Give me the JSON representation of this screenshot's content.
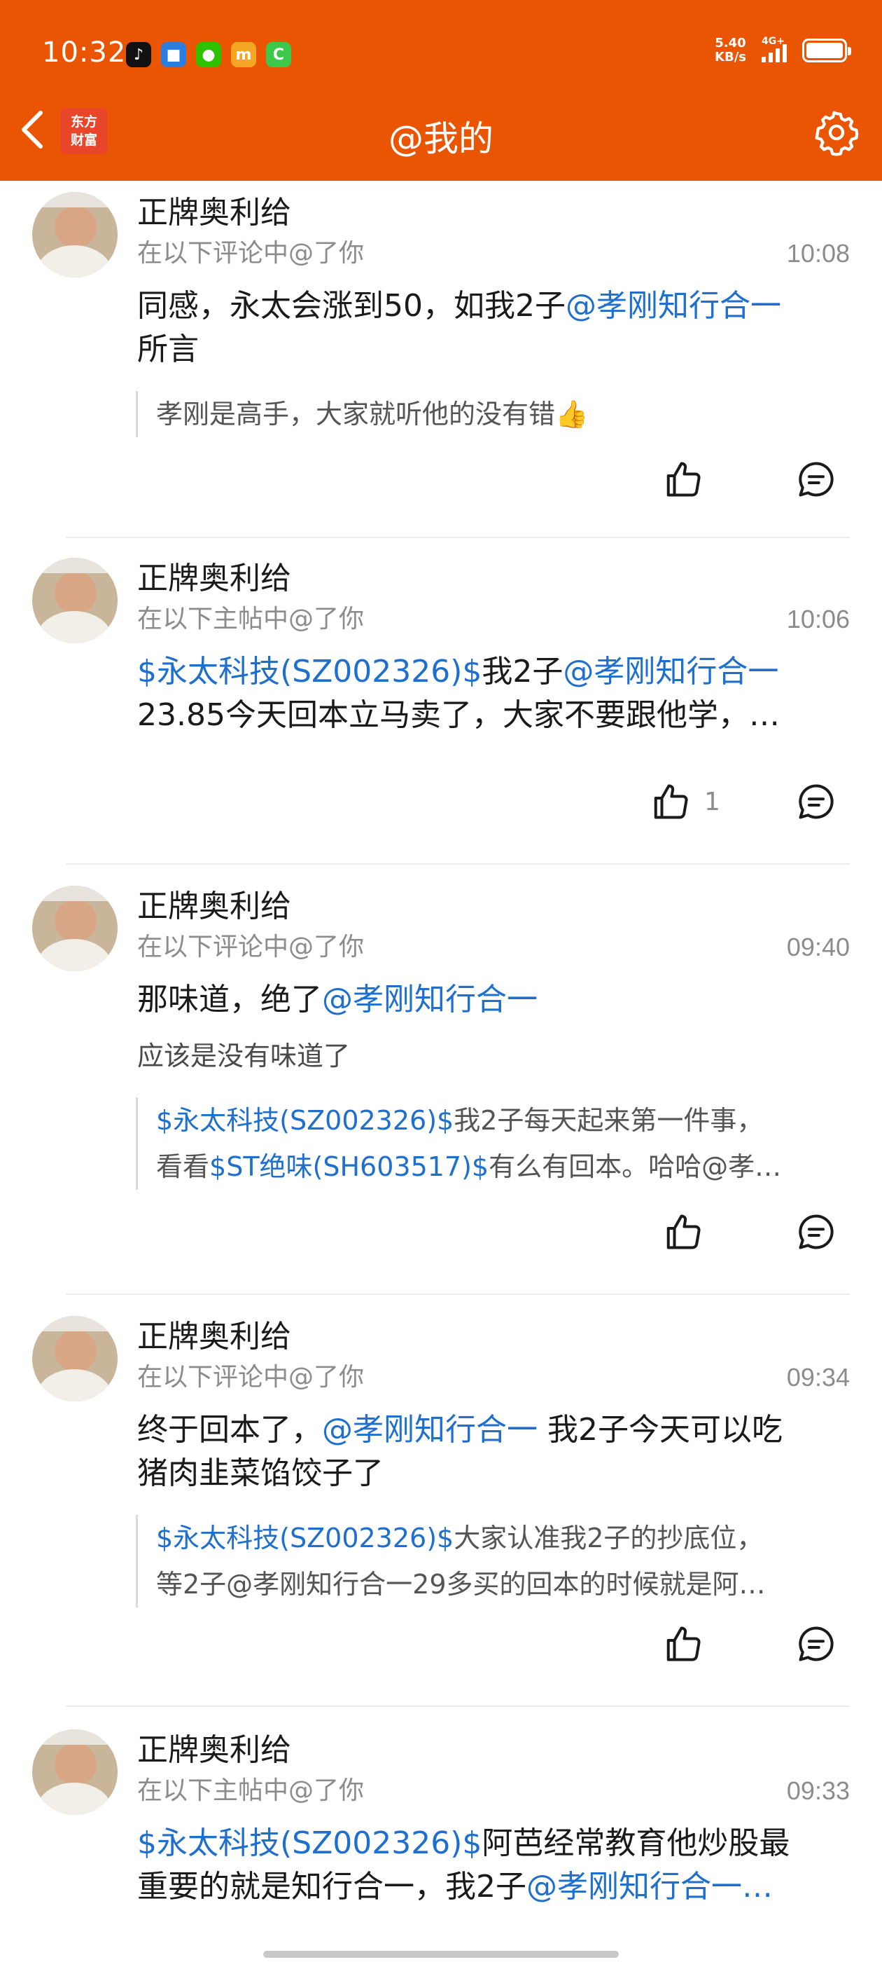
{
  "status_bar": {
    "time": "10:32",
    "speed_value": "5.40",
    "speed_unit": "KB/s",
    "network": "4G+",
    "apps": [
      {
        "icon": "tiktok-icon",
        "glyph": "♪",
        "color": "#111111"
      },
      {
        "icon": "app-icon",
        "glyph": "■",
        "color": "#2a7de1"
      },
      {
        "icon": "wechat-icon",
        "glyph": "●",
        "color": "#2dc100"
      },
      {
        "icon": "m-app-icon",
        "glyph": "m",
        "color": "#f5a623"
      },
      {
        "icon": "c-app-icon",
        "glyph": "C",
        "color": "#3ec84a"
      }
    ]
  },
  "header": {
    "title": "@我的",
    "logo_line1": "东方",
    "logo_line2": "财富",
    "bg_color": "#ea5504"
  },
  "items": [
    {
      "name": "正牌奥利给",
      "context": "在以下评论中@了你",
      "time": "10:08",
      "body_line1_a": "同感，永太会涨到50，如我2子",
      "body_line1_link": "@孝刚知行合一",
      "body_line2": "所言",
      "quote": "孝刚是高手，大家就听他的没有错👍",
      "like_count": ""
    },
    {
      "name": "正牌奥利给",
      "context": "在以下主帖中@了你",
      "time": "10:06",
      "body_line1_link1": "$永太科技(SZ002326)$",
      "body_line1_text": "我2子",
      "body_line1_link2": "@孝刚知行合一",
      "body_line2": "23.85今天回本立马卖了，大家不要跟他学，…",
      "like_count": "1"
    },
    {
      "name": "正牌奥利给",
      "context": "在以下评论中@了你",
      "time": "09:40",
      "body_text": "那味道，绝了",
      "body_link": "@孝刚知行合一",
      "reply": "应该是没有味道了",
      "quote_l1_link": "$永太科技(SZ002326)$",
      "quote_l1_text": "我2子每天起来第一件事，",
      "quote_l2_a": "看看",
      "quote_l2_link": "$ST绝味(SH603517)$",
      "quote_l2_b": "有么有回本。哈哈@孝…"
    },
    {
      "name": "正牌奥利给",
      "context": "在以下评论中@了你",
      "time": "09:34",
      "body_line1_a": "终于回本了，",
      "body_line1_link": "@孝刚知行合一",
      "body_line1_b": " 我2子今天可以吃",
      "body_line2": "猪肉韭菜馅饺子了",
      "quote_l1_link": "$永太科技(SZ002326)$",
      "quote_l1_text": "大家认准我2子的抄底位，",
      "quote_l2": "等2子@孝刚知行合一29多买的回本的时候就是阿…"
    },
    {
      "name": "正牌奥利给",
      "context": "在以下主帖中@了你",
      "time": "09:33",
      "body_line1_link": "$永太科技(SZ002326)$",
      "body_line1_text": "阿芭经常教育他炒股最",
      "body_line2_a": "重要的就是知行合一，我2子",
      "body_line2_link": "@孝刚知行合一…"
    }
  ]
}
